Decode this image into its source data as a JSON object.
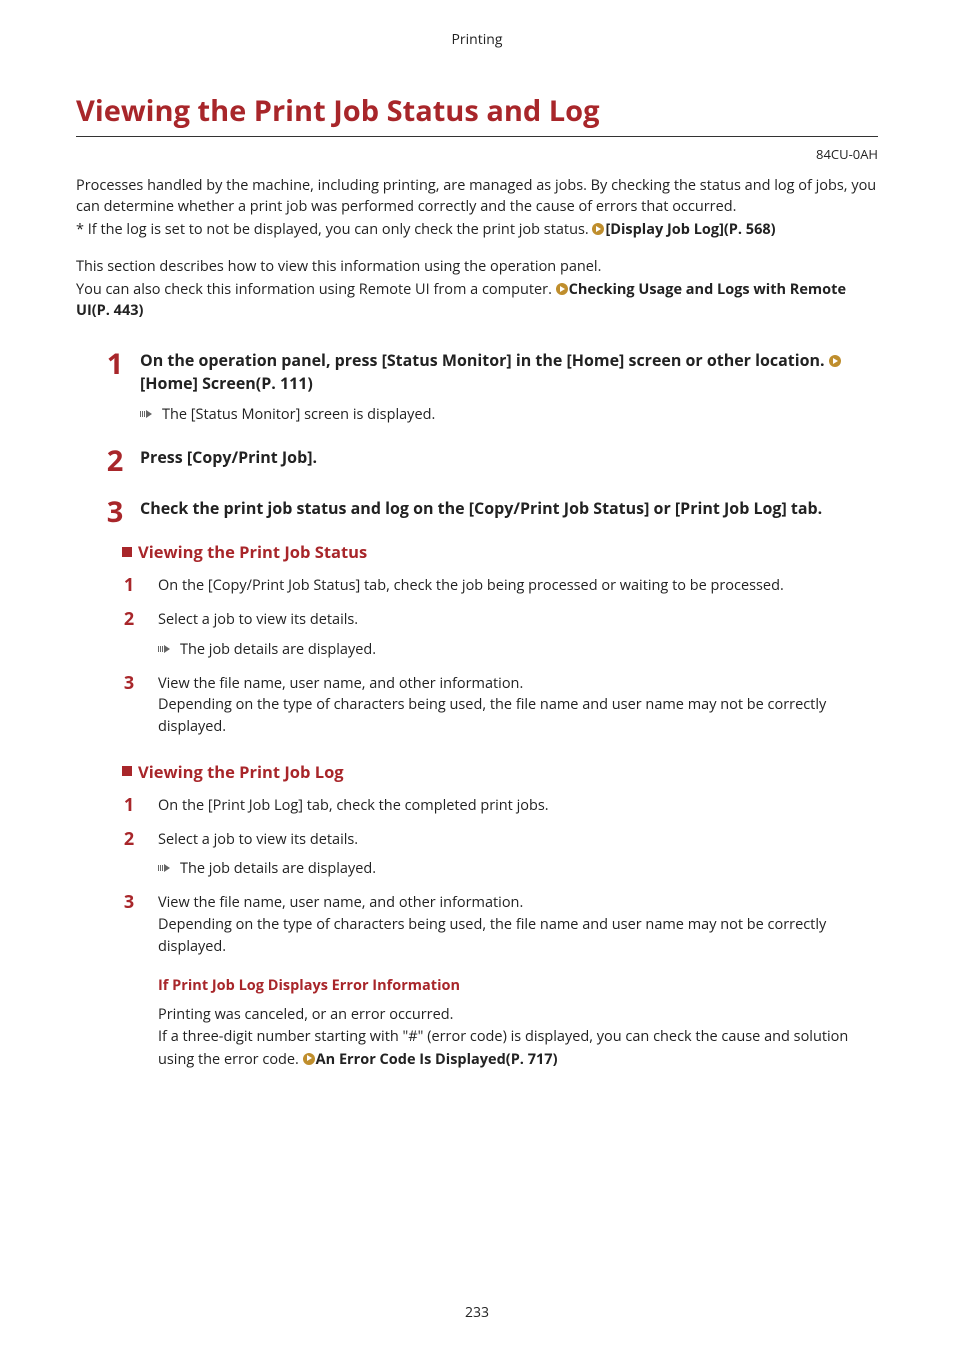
{
  "section_header": "Printing",
  "title": "Viewing the Print Job Status and Log",
  "doc_code": "84CU-0AH",
  "intro": {
    "p1": "Processes handled by the machine, including printing, are managed as jobs. By checking the status and log of jobs, you can determine whether a print job was performed correctly and the cause of errors that occurred.",
    "p2_prefix": "* If the log is set to not be displayed, you can only check the print job status. ",
    "p2_link": "[Display Job Log](P. 568)",
    "p3": "This section describes how to view this information using the operation panel.",
    "p4_prefix": "You can also check this information using Remote UI from a computer. ",
    "p4_link": "Checking Usage and Logs with Remote UI(P. 443)"
  },
  "steps": [
    {
      "num": "1",
      "head_prefix": "On the operation panel, press [Status Monitor] in the [Home] screen or other location. ",
      "head_link": "[Home] Screen(P. 111)",
      "result": "The [Status Monitor] screen is displayed."
    },
    {
      "num": "2",
      "head": "Press [Copy/Print Job]."
    },
    {
      "num": "3",
      "head": "Check the print job status and log on the [Copy/Print Job Status] or [Print Job Log] tab."
    }
  ],
  "sub1": {
    "title": "Viewing the Print Job Status",
    "items": [
      {
        "num": "1",
        "text": "On the [Copy/Print Job Status] tab, check the job being processed or waiting to be processed."
      },
      {
        "num": "2",
        "text": "Select a job to view its details.",
        "result": "The job details are displayed."
      },
      {
        "num": "3",
        "text": "View the file name, user name, and other information.\nDepending on the type of characters being used, the file name and user name may not be correctly displayed."
      }
    ]
  },
  "sub2": {
    "title": "Viewing the Print Job Log",
    "items": [
      {
        "num": "1",
        "text": "On the [Print Job Log] tab, check the completed print jobs."
      },
      {
        "num": "2",
        "text": "Select a job to view its details.",
        "result": "The job details are displayed."
      },
      {
        "num": "3",
        "text": "View the file name, user name, and other information.\nDepending on the type of characters being used, the file name and user name may not be correctly displayed."
      }
    ]
  },
  "error": {
    "title": "If Print Job Log Displays Error Information",
    "p1": "Printing was canceled, or an error occurred.",
    "p2_prefix": "If a three-digit number starting with \"#\" (error code) is displayed, you can check the cause and solution using the error code. ",
    "link": "An Error Code Is Displayed(P. 717)"
  },
  "page_number": "233"
}
